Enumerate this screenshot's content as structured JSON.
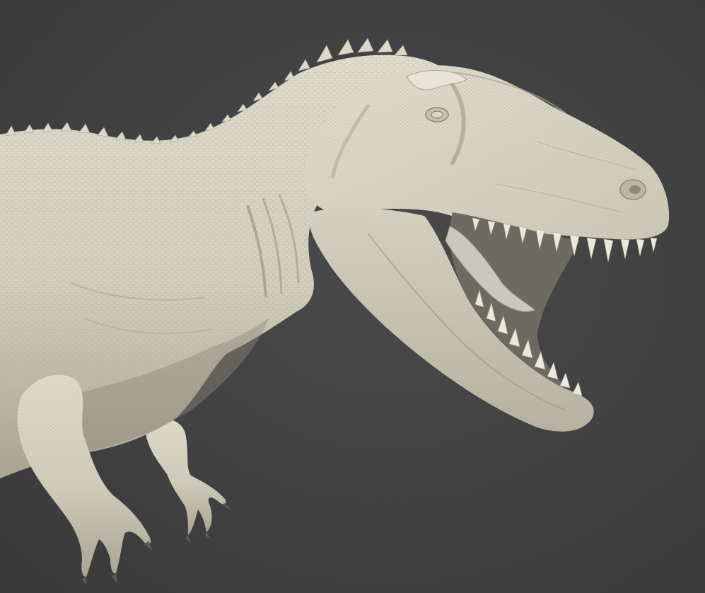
{
  "scene": {
    "subject_icon": "dinosaur-icon",
    "colors": {
      "background": "#404040",
      "background_light": "#4a4a4a",
      "skin": "#d9d5c4",
      "skin_shadow": "#a8a391",
      "skin_dark": "#7f7a6a",
      "mouth_dark": "#6d6a5f",
      "tongue": "#c9c7c0",
      "teeth": "#ece9dc"
    }
  }
}
